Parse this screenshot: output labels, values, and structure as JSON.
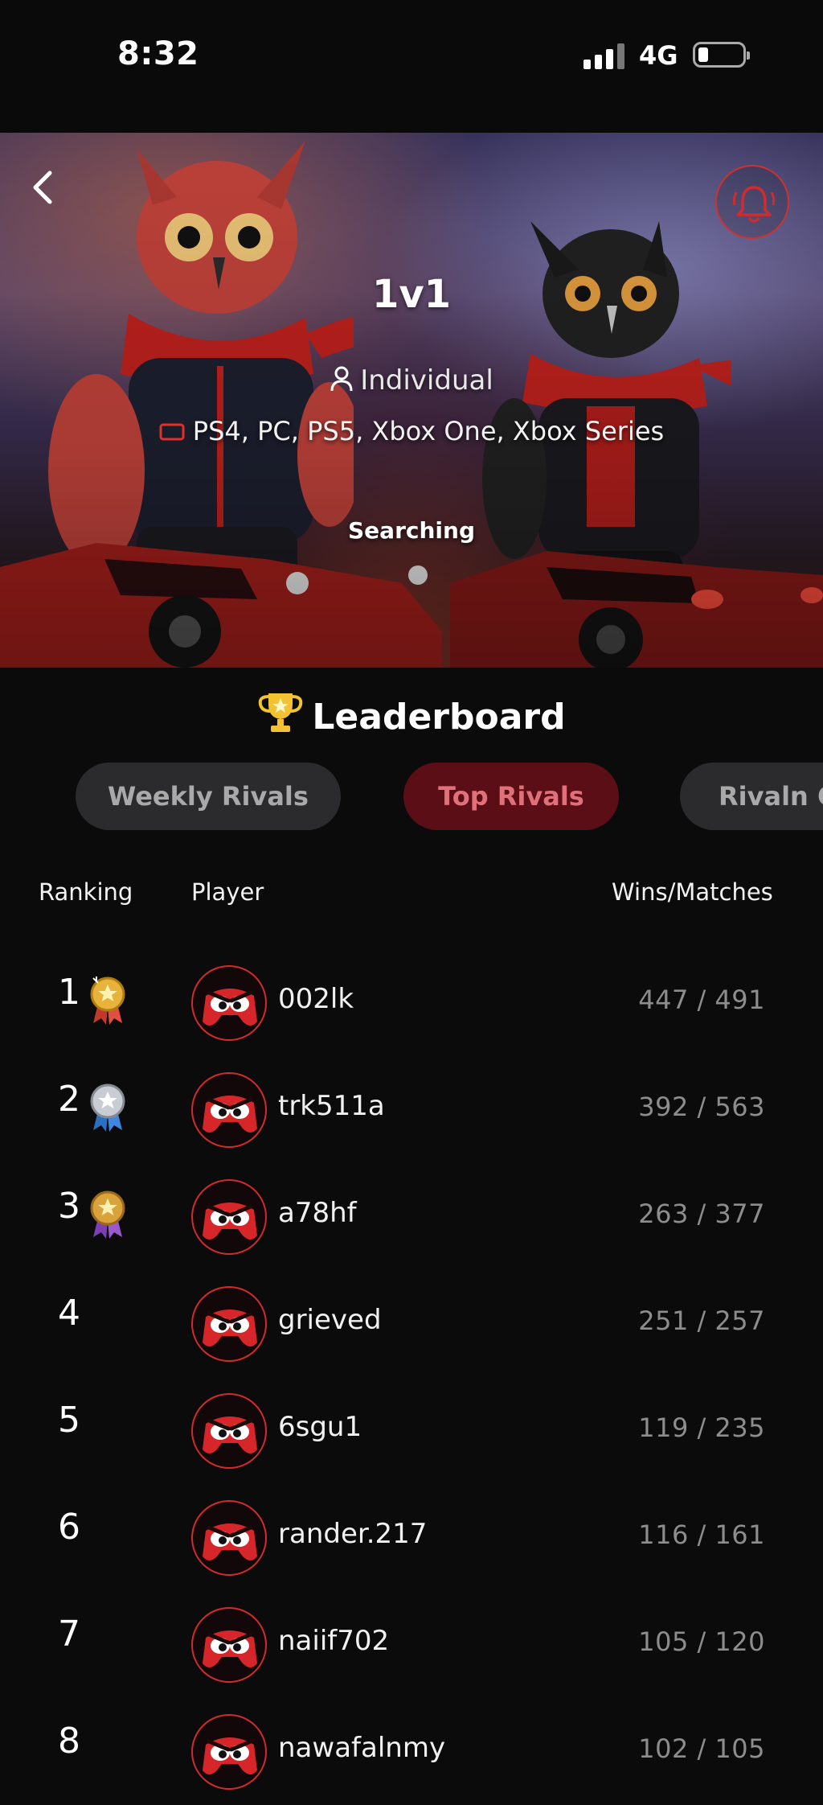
{
  "status_bar": {
    "time": "8:32",
    "network": "4G"
  },
  "hero": {
    "title": "1v1",
    "type_icon": "person-icon",
    "type_label": "Individual",
    "platform_icon": "gamepad-icon",
    "platforms": "PS4, PC, PS5, Xbox One, Xbox Series",
    "status": "Searching"
  },
  "leaderboard": {
    "title": "Leaderboard",
    "tabs": [
      {
        "label": "Weekly Rivals",
        "active": false
      },
      {
        "label": "Top Rivals",
        "active": true
      },
      {
        "label": "Rivaln G",
        "active": false
      }
    ],
    "columns": {
      "ranking": "Ranking",
      "player": "Player",
      "score": "Wins/Matches"
    },
    "rows": [
      {
        "rank": "1",
        "medal": "gold",
        "player": "002lk",
        "score": "447 / 491"
      },
      {
        "rank": "2",
        "medal": "silver",
        "player": "trk511a",
        "score": "392 / 563"
      },
      {
        "rank": "3",
        "medal": "bronze",
        "player": "a78hf",
        "score": "263 / 377"
      },
      {
        "rank": "4",
        "medal": null,
        "player": "grieved",
        "score": "251 / 257"
      },
      {
        "rank": "5",
        "medal": null,
        "player": "6sgu1",
        "score": "119 / 235"
      },
      {
        "rank": "6",
        "medal": null,
        "player": "rander.217",
        "score": "116 / 161"
      },
      {
        "rank": "7",
        "medal": null,
        "player": "naiif702",
        "score": "105 / 120"
      },
      {
        "rank": "8",
        "medal": null,
        "player": "nawafalnmy",
        "score": "102 / 105"
      }
    ]
  },
  "colors": {
    "accent_red": "#d02c2e",
    "active_tab_bg": "#5b0e16",
    "active_tab_text": "#e0707a",
    "inactive_tab_bg": "#2b2b2d",
    "background": "#0b0b0c"
  }
}
